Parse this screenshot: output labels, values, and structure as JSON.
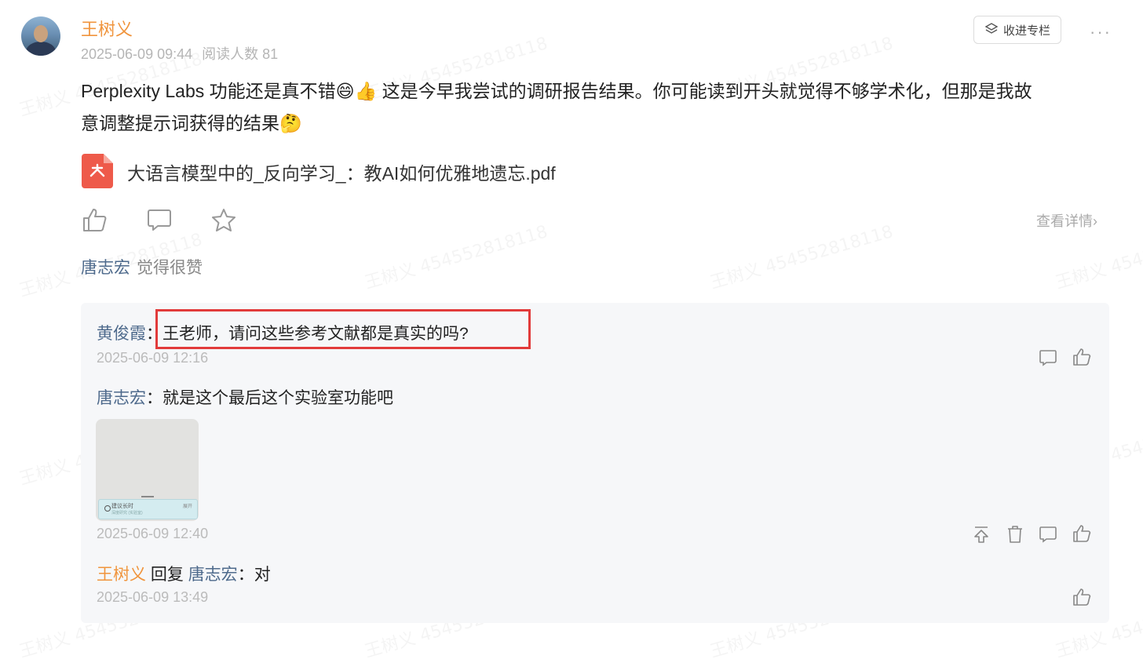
{
  "post": {
    "author": "王树义",
    "date": "2025-06-09 09:44",
    "read_label": "阅读人数 81",
    "follow_label": "收进专栏",
    "more": "···",
    "text_line1": "Perplexity Labs 功能还是真不错😄👍 这是今早我尝试的调研报告结果。你可能读到开头就觉得不够学术化，但那是我故",
    "text_line2": "意调整提示词获得的结果🤔",
    "attachment": "大语言模型中的_反向学习_：教AI如何优雅地遗忘.pdf",
    "detail_label": "查看详情",
    "detail_chevron": "›",
    "liker": "唐志宏",
    "liker_suffix": "觉得很赞"
  },
  "watermark": "王树义 454552818118",
  "comments": [
    {
      "author": "黄俊霞",
      "sep": "：",
      "text": "王老师，请问这些参考文献都是真实的吗?",
      "time": "2025-06-09 12:16"
    },
    {
      "author": "唐志宏",
      "sep": "：",
      "text": "就是这个最后这个实验室功能吧",
      "time": "2025-06-09 12:40",
      "image": {
        "title": "建议长时",
        "subtitle": "深度研究 (实验室)",
        "right": "展开"
      }
    },
    {
      "author": "王树义",
      "reply_word": "回复",
      "reply_to": "唐志宏",
      "sep": "：",
      "text": "对",
      "time": "2025-06-09 13:49"
    }
  ],
  "colors": {
    "author": "#f0943c",
    "name": "#4e6a8c",
    "highlight": "#e23b3b",
    "pdf": "#ee5a4a"
  },
  "icons": [
    "like-icon",
    "comment-icon",
    "star-icon",
    "chevron-right-icon",
    "pin-top-icon",
    "trash-icon",
    "pdf-icon",
    "column-icon"
  ]
}
